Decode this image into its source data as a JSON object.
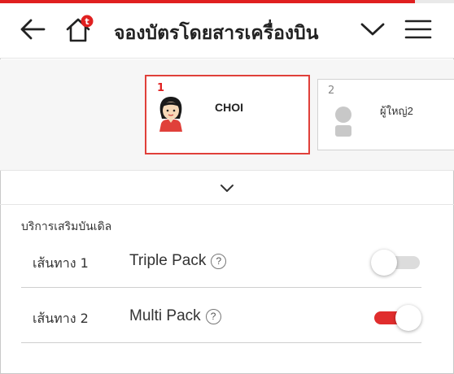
{
  "header": {
    "title": "จองบัตรโดยสารเครื่องบิน",
    "back_icon": "back-arrow-icon",
    "home_icon": "home-icon",
    "home_badge": "t",
    "dropdown_icon": "chevron-down-icon",
    "menu_icon": "hamburger-menu-icon"
  },
  "passengers": [
    {
      "number": "1",
      "name": "CHOI",
      "selected": true,
      "avatar": "female-avatar-icon"
    },
    {
      "number": "2",
      "name": "ผู้ใหญ่2",
      "selected": false,
      "avatar": "person-placeholder-icon"
    }
  ],
  "expand_icon": "chevron-down-icon",
  "entertainment": {
    "section_title": "บริการเสริมบันเดิล",
    "help_symbol": "?",
    "rows": [
      {
        "route": "เส้นทาง 1",
        "pack": "Triple Pack",
        "enabled": false
      },
      {
        "route": "เส้นทาง 2",
        "pack": "Multi Pack",
        "enabled": true
      }
    ]
  },
  "colors": {
    "accent": "#e02020",
    "toggle_on": "#e02d2d",
    "toggle_off": "#dcdcdc"
  }
}
